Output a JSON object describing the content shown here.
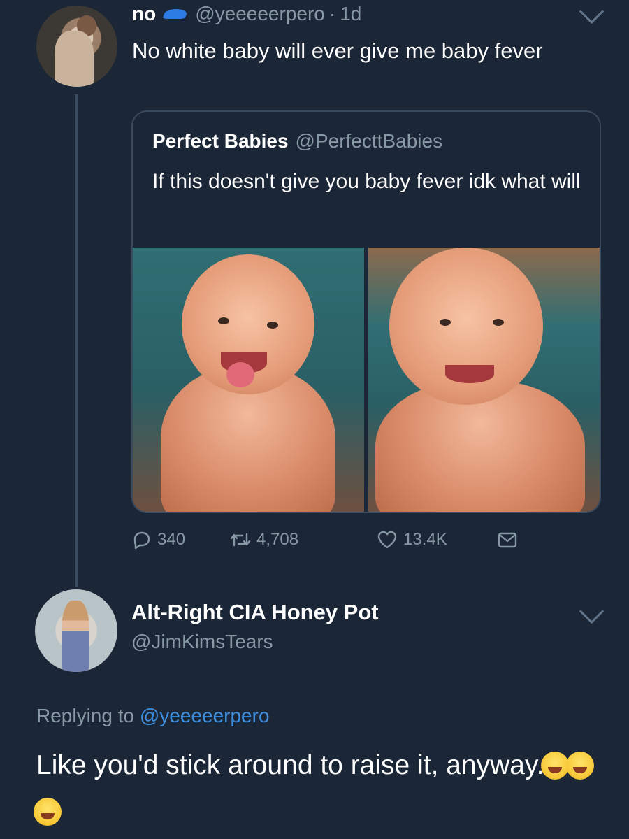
{
  "tweet1": {
    "display_name": "no",
    "handle": "@yeeeeerpero",
    "separator": "·",
    "time": "1d",
    "text": "No white baby will ever give me baby fever",
    "verified_cap_icon": "blue-cap-icon"
  },
  "quote": {
    "display_name": "Perfect Babies",
    "handle": "@PerfecttBabies",
    "text": "If this doesn't give you baby fever idk what will"
  },
  "actions": {
    "replies": "340",
    "retweets": "4,708",
    "likes": "13.4K",
    "icons": [
      "reply-icon",
      "retweet-icon",
      "like-icon",
      "share-icon"
    ]
  },
  "tweet2": {
    "display_name": "Alt-Right CIA Honey Pot",
    "handle": "@JimKimsTears",
    "replying_prefix": "Replying to",
    "replying_to": "@yeeeeerpero",
    "text": "Like you'd stick around to raise it, anyway.",
    "emojis": [
      "rolling-on-floor-laughing-emoji",
      "tears-of-joy-emoji",
      "grinning-face-emoji"
    ]
  },
  "colors": {
    "background": "#1b2637",
    "secondary_text": "#8899a6",
    "link": "#3e8fe0",
    "card_border": "#3a4a5e"
  }
}
